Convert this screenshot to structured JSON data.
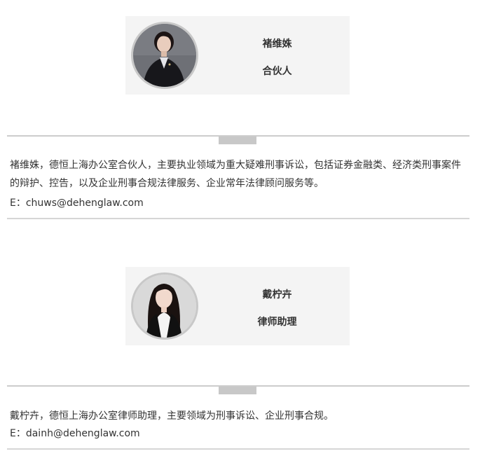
{
  "people": [
    {
      "name": "褚维姝",
      "title": "合伙人",
      "avatar_icon": "portrait-dark-suit",
      "bio": "褚维姝，德恒上海办公室合伙人，主要执业领域为重大疑难刑事诉讼，包括证券金融类、经济类刑事案件的辩护、控告，以及企业刑事合规法律服务、企业常年法律顾问服务等。",
      "email": "E：chuws@dehenglaw.com"
    },
    {
      "name": "戴柠卉",
      "title": "律师助理",
      "avatar_icon": "portrait-long-hair",
      "bio": "戴柠卉，德恒上海办公室律师助理，主要领域为刑事诉讼、企业刑事合规。",
      "email": "E：dainh@dehenglaw.com"
    }
  ],
  "colors": {
    "card_bg": "#f4f4f4",
    "divider": "#cccccc",
    "text": "#333333"
  }
}
